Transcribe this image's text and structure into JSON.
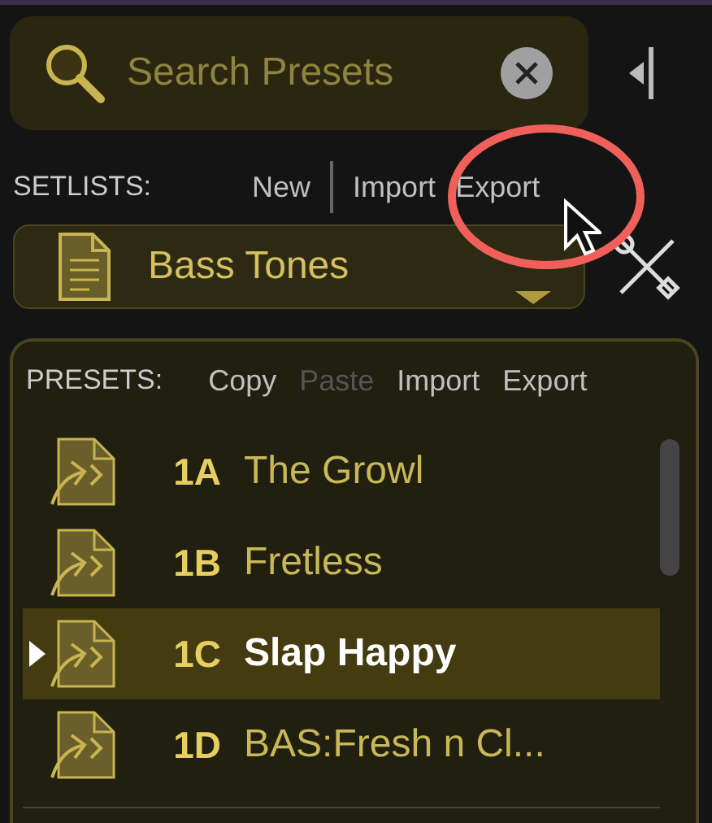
{
  "search": {
    "placeholder": "Search Presets"
  },
  "setlists": {
    "label": "SETLISTS:",
    "actions": [
      {
        "label": "New",
        "disabled": false
      },
      {
        "label": "Import",
        "disabled": false
      },
      {
        "label": "Export",
        "disabled": false
      }
    ],
    "current": "Bass Tones"
  },
  "presets": {
    "label": "PRESETS:",
    "actions": [
      {
        "label": "Copy",
        "disabled": false
      },
      {
        "label": "Paste",
        "disabled": true
      },
      {
        "label": "Import",
        "disabled": false
      },
      {
        "label": "Export",
        "disabled": false
      }
    ],
    "rows": [
      {
        "number": "1A",
        "name": "The Growl",
        "selected": false
      },
      {
        "number": "1B",
        "name": "Fretless",
        "selected": false
      },
      {
        "number": "1C",
        "name": "Slap Happy",
        "selected": true
      },
      {
        "number": "1D",
        "name": "BAS:Fresh n Cl...",
        "selected": false
      }
    ]
  }
}
